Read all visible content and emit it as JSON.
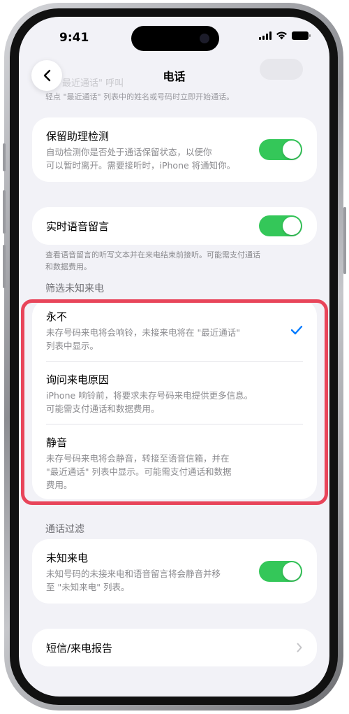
{
  "status_bar": {
    "time": "9:41"
  },
  "nav": {
    "title": "电话"
  },
  "ghost": {
    "row_label": "\"最近通话\" 呼叫",
    "footnote": "轻点 \"最近通话\" 列表中的姓名或号码时立即开始通话。"
  },
  "call_hold_assist": {
    "title": "保留助理检测",
    "subtitle_line1": "自动检测你是否处于通话保留状态，以便你",
    "subtitle_line2": "可以暂时离开。需要接听时，iPhone 将通知你。",
    "enabled": true
  },
  "live_voicemail": {
    "title": "实时语音留言",
    "enabled": true,
    "footnote_line1": "查看语音留言的听写文本并在来电结束前接听。可能需支付通话",
    "footnote_line2": "和数据费用。"
  },
  "screen_unknown_callers": {
    "header": "筛选未知来电",
    "options": [
      {
        "title": "永不",
        "subtitle_line1": "未存号码来电将会响铃，未接来电将在 \"最近通话\"",
        "subtitle_line2": "列表中显示。",
        "selected": true
      },
      {
        "title": "询问来电原因",
        "subtitle_line1": "iPhone 响铃前，将要求未存号码来电提供更多信息。",
        "subtitle_line2": "可能需支付通话和数据费用。",
        "selected": false
      },
      {
        "title": "静音",
        "subtitle_line1": "未存号码来电将会静音，转接至语音信箱，并在",
        "subtitle_line2": "\"最近通话\" 列表中显示。可能需支付通话和数据",
        "subtitle_line3": "费用。",
        "selected": false
      }
    ]
  },
  "call_filtering": {
    "header": "通话过滤",
    "unknown_callers": {
      "title": "未知来电",
      "subtitle_line1": "未知号码的未接来电和语音留言将会静音并移",
      "subtitle_line2": "至 \"未知来电\" 列表。",
      "enabled": true
    }
  },
  "sms_call_reporting": {
    "title": "短信/来电报告"
  },
  "colors": {
    "toggle_on": "#34c759",
    "accent": "#007aff",
    "highlight": "#e8455a",
    "background": "#f2f2f7"
  },
  "icons": {
    "back": "chevron-left-icon",
    "check": "checkmark-icon",
    "disclosure": "chevron-right-icon",
    "signal": "cellular-signal-icon",
    "wifi": "wifi-icon",
    "battery": "battery-icon"
  }
}
